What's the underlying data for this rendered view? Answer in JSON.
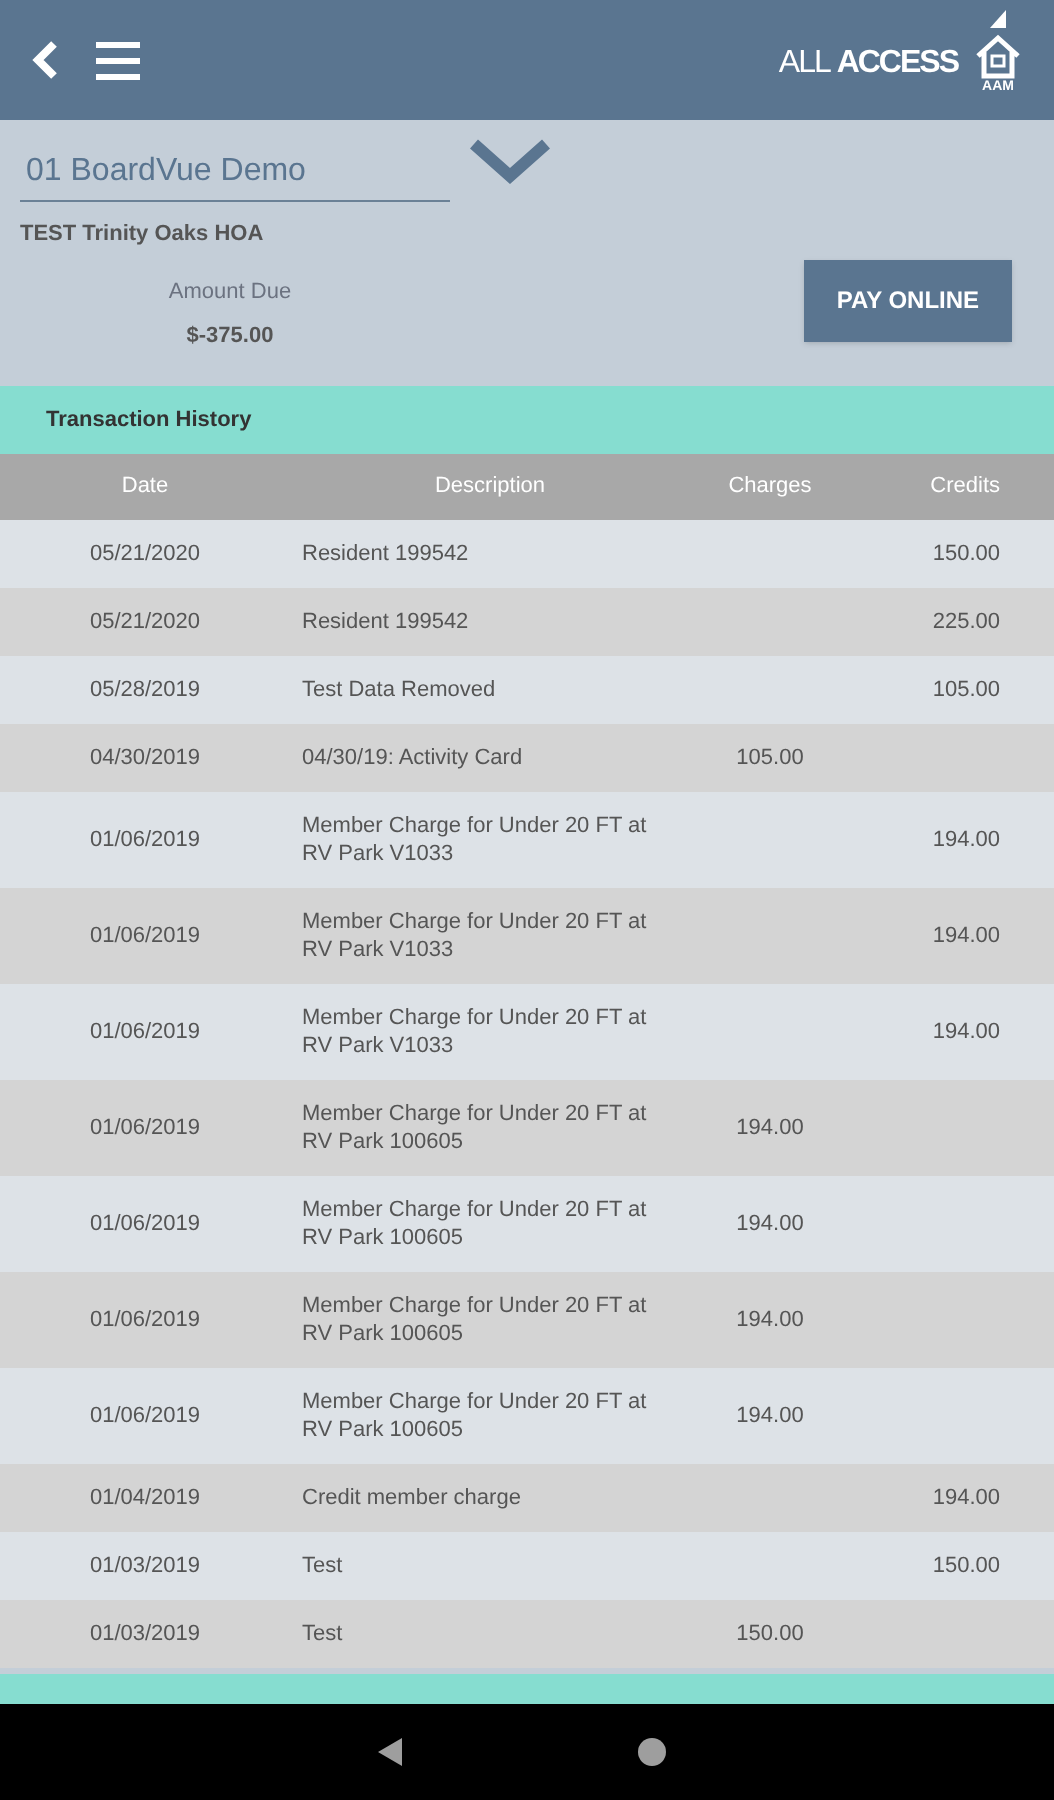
{
  "header": {
    "brand": {
      "light": "ALL",
      "bold": "ACCESS",
      "mark": "AAM"
    }
  },
  "account": {
    "selector": "01 BoardVue Demo",
    "association": "TEST Trinity Oaks HOA",
    "amount_label": "Amount Due",
    "amount": "$-375.00",
    "pay_button": "PAY ONLINE"
  },
  "section": {
    "title": "Transaction History"
  },
  "table": {
    "columns": [
      "Date",
      "Description",
      "Charges",
      "Credits"
    ],
    "rows": [
      [
        "05/21/2020",
        "Resident 199542",
        "",
        "150.00"
      ],
      [
        "05/21/2020",
        "Resident 199542",
        "",
        "225.00"
      ],
      [
        "05/28/2019",
        "Test Data Removed",
        "",
        "105.00"
      ],
      [
        "04/30/2019",
        "04/30/19: Activity Card",
        "105.00",
        ""
      ],
      [
        "01/06/2019",
        "Member Charge for Under 20 FT at RV Park V1033",
        "",
        "194.00"
      ],
      [
        "01/06/2019",
        "Member Charge for Under 20 FT at RV Park V1033",
        "",
        "194.00"
      ],
      [
        "01/06/2019",
        "Member Charge for Under 20 FT at RV Park V1033",
        "",
        "194.00"
      ],
      [
        "01/06/2019",
        "Member Charge for Under 20 FT at RV Park 100605",
        "194.00",
        ""
      ],
      [
        "01/06/2019",
        "Member Charge for Under 20 FT at RV Park 100605",
        "194.00",
        ""
      ],
      [
        "01/06/2019",
        "Member Charge for Under 20 FT at RV Park 100605",
        "194.00",
        ""
      ],
      [
        "01/06/2019",
        "Member Charge for Under 20 FT at RV Park 100605",
        "194.00",
        ""
      ],
      [
        "01/04/2019",
        "Credit member charge",
        "",
        "194.00"
      ],
      [
        "01/03/2019",
        "Test",
        "",
        "150.00"
      ],
      [
        "01/03/2019",
        "Test",
        "150.00",
        ""
      ]
    ]
  }
}
